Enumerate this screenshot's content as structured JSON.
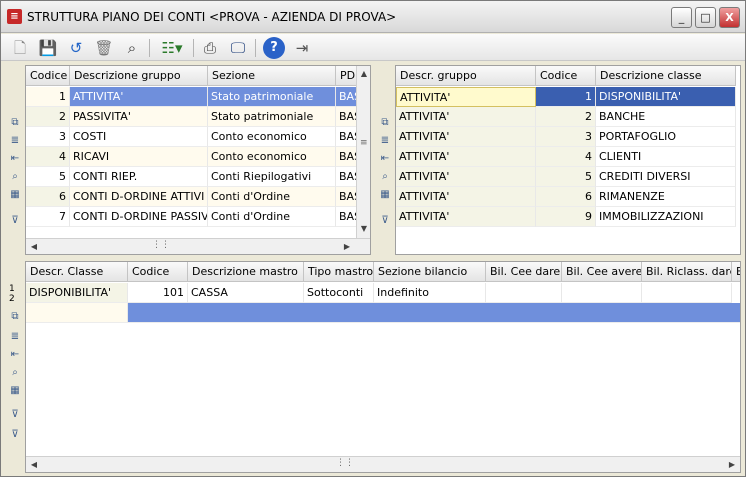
{
  "window": {
    "title": "STRUTTURA PIANO DEI CONTI <PROVA - AZIENDA DI PROVA>",
    "minimize": "_",
    "maximize": "□",
    "close": "X"
  },
  "colors": {
    "selection": "#6f8fdc",
    "selection_dark": "#3a5fb0",
    "alt_row": "#fffbee"
  },
  "toolbar": {
    "icons": [
      "new-icon",
      "save-icon",
      "undo-icon",
      "delete-icon",
      "find-icon",
      "list-icon",
      "print-icon",
      "preview-icon",
      "help-icon",
      "exit-icon"
    ]
  },
  "groups": {
    "columns": [
      "Codice",
      "Descrizione gruppo",
      "Sezione",
      "PD"
    ],
    "rows": [
      {
        "code": "1",
        "desc": "ATTIVITA'",
        "sezione": "Stato patrimoniale",
        "pd": "BAS"
      },
      {
        "code": "2",
        "desc": "PASSIVITA'",
        "sezione": "Stato patrimoniale",
        "pd": "BAS"
      },
      {
        "code": "3",
        "desc": "COSTI",
        "sezione": "Conto economico",
        "pd": "BAS"
      },
      {
        "code": "4",
        "desc": "RICAVI",
        "sezione": "Conto economico",
        "pd": "BAS"
      },
      {
        "code": "5",
        "desc": "CONTI RIEP.",
        "sezione": "Conti Riepilogativi",
        "pd": "BAS"
      },
      {
        "code": "6",
        "desc": "CONTI D-ORDINE ATTIVI",
        "sezione": "Conti d'Ordine",
        "pd": "BAS"
      },
      {
        "code": "7",
        "desc": "CONTI D-ORDINE PASSIVI",
        "sezione": "Conti d'Ordine",
        "pd": "BAS"
      }
    ]
  },
  "classes": {
    "columns": [
      "Descr. gruppo",
      "Codice",
      "Descrizione classe"
    ],
    "rows": [
      {
        "gruppo": "ATTIVITA'",
        "code": "1",
        "desc": "DISPONIBILITA'"
      },
      {
        "gruppo": "ATTIVITA'",
        "code": "2",
        "desc": "BANCHE"
      },
      {
        "gruppo": "ATTIVITA'",
        "code": "3",
        "desc": "PORTAFOGLIO"
      },
      {
        "gruppo": "ATTIVITA'",
        "code": "4",
        "desc": "CLIENTI"
      },
      {
        "gruppo": "ATTIVITA'",
        "code": "5",
        "desc": "CREDITI DIVERSI"
      },
      {
        "gruppo": "ATTIVITA'",
        "code": "6",
        "desc": "RIMANENZE"
      },
      {
        "gruppo": "ATTIVITA'",
        "code": "9",
        "desc": "IMMOBILIZZAZIONI"
      }
    ]
  },
  "mastri": {
    "columns": [
      "Descr. Classe",
      "Codice",
      "Descrizione mastro",
      "Tipo mastro",
      "Sezione bilancio",
      "Bil. Cee dare",
      "Bil. Cee avere",
      "Bil. Riclass. dare",
      "B"
    ],
    "row_numbers": [
      "1",
      "2"
    ],
    "rows": [
      {
        "classe": "DISPONIBILITA'",
        "code": "101",
        "desc": "CASSA",
        "tipo": "Sottoconti",
        "sezione": "Indefinito"
      }
    ]
  }
}
